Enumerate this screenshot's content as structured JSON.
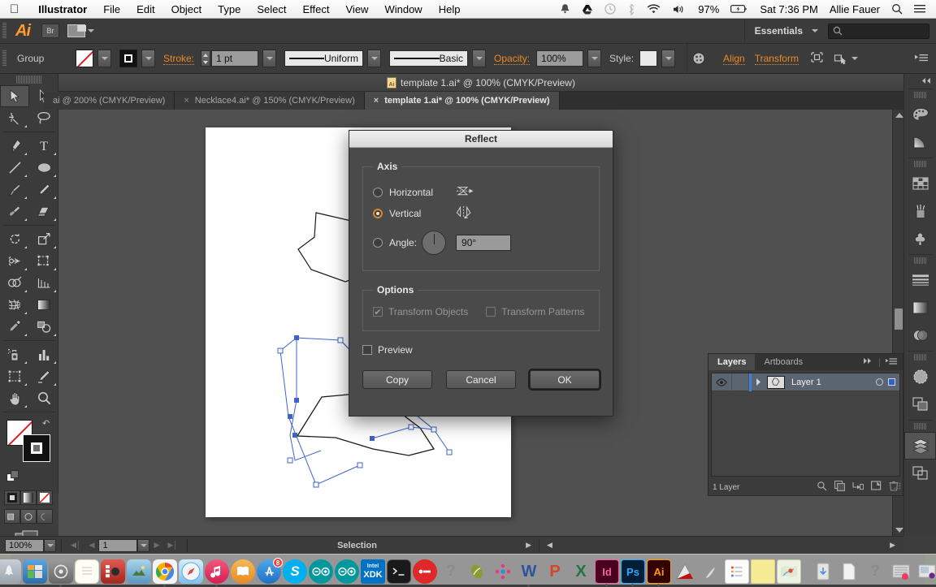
{
  "menubar": {
    "apple": "apple-logo",
    "app": "Illustrator",
    "items": [
      "File",
      "Edit",
      "Object",
      "Type",
      "Select",
      "Effect",
      "View",
      "Window",
      "Help"
    ],
    "status": {
      "battery": "97%",
      "datetime": "Sat 7:36 PM",
      "user": "Allie Fauer",
      "icons": [
        "bell-icon",
        "drive-icon",
        "time-machine-icon",
        "bluetooth-icon",
        "wifi-icon",
        "volume-icon",
        "battery-icon",
        "spotlight-icon",
        "notification-center-icon"
      ]
    }
  },
  "appbar": {
    "logo": "Ai",
    "bridge_label": "Br",
    "arrange_label": "arrange-documents",
    "workspace": "Essentials",
    "search_placeholder": ""
  },
  "control": {
    "selection_label": "Group",
    "fill_label": "fill-none",
    "stroke_swatch_label": "stroke-black",
    "stroke_label": "Stroke:",
    "stroke_weight": "1 pt",
    "variable_width": "Uniform",
    "brush": "Basic",
    "opacity_label": "Opacity:",
    "opacity_value": "100%",
    "style_label": "Style:",
    "align_label": "Align",
    "transform_label": "Transform",
    "isolate_icon": "isolate-selected-object-icon",
    "select_similar_icon": "select-similar-objects-icon",
    "panel_menu_icon": "panel-menu-icon"
  },
  "document": {
    "title": "template 1.ai* @ 100% (CMYK/Preview)",
    "tabs": [
      {
        "label": "ai @ 200% (CMYK/Preview)",
        "active": false,
        "closable": false
      },
      {
        "label": "Necklace4.ai* @ 150% (CMYK/Preview)",
        "active": false,
        "closable": true
      },
      {
        "label": "template 1.ai* @ 100% (CMYK/Preview)",
        "active": true,
        "closable": true
      }
    ],
    "close_label": "×"
  },
  "tools": [
    {
      "name": "selection-tool",
      "selected": true
    },
    {
      "name": "direct-selection-tool",
      "selected": false
    },
    {
      "name": "magic-wand-tool",
      "selected": false
    },
    {
      "name": "lasso-tool",
      "selected": false
    },
    {
      "name": "pen-tool",
      "selected": false
    },
    {
      "name": "type-tool",
      "selected": false
    },
    {
      "name": "line-segment-tool",
      "selected": false
    },
    {
      "name": "ellipse-tool",
      "selected": false
    },
    {
      "name": "paintbrush-tool",
      "selected": false
    },
    {
      "name": "pencil-tool",
      "selected": false
    },
    {
      "name": "blob-brush-tool",
      "selected": false
    },
    {
      "name": "eraser-tool",
      "selected": false
    },
    {
      "name": "rotate-tool",
      "selected": false
    },
    {
      "name": "scale-tool",
      "selected": false
    },
    {
      "name": "width-tool",
      "selected": false
    },
    {
      "name": "free-transform-tool",
      "selected": false
    },
    {
      "name": "shape-builder-tool",
      "selected": false
    },
    {
      "name": "perspective-grid-tool",
      "selected": false
    },
    {
      "name": "mesh-tool",
      "selected": false
    },
    {
      "name": "gradient-tool",
      "selected": false
    },
    {
      "name": "eyedropper-tool",
      "selected": false
    },
    {
      "name": "blend-tool",
      "selected": false
    },
    {
      "name": "symbol-sprayer-tool",
      "selected": false
    },
    {
      "name": "column-graph-tool",
      "selected": false
    },
    {
      "name": "artboard-tool",
      "selected": false
    },
    {
      "name": "slice-tool",
      "selected": false
    },
    {
      "name": "hand-tool",
      "selected": false
    },
    {
      "name": "zoom-tool",
      "selected": false
    }
  ],
  "dialog": {
    "title": "Reflect",
    "axis_legend": "Axis",
    "horizontal_label": "Horizontal",
    "horizontal_selected": false,
    "vertical_label": "Vertical",
    "vertical_selected": true,
    "angle_label": "Angle:",
    "angle_selected": false,
    "angle_value": "90°",
    "options_legend": "Options",
    "transform_objects_label": "Transform Objects",
    "transform_objects_checked": true,
    "transform_patterns_label": "Transform Patterns",
    "transform_patterns_checked": false,
    "preview_label": "Preview",
    "preview_checked": false,
    "copy_label": "Copy",
    "cancel_label": "Cancel",
    "ok_label": "OK",
    "check_glyph": "✔"
  },
  "layers": {
    "tabs": [
      {
        "label": "Layers",
        "active": true
      },
      {
        "label": "Artboards",
        "active": false
      }
    ],
    "collapse_icon": "collapse-panel-icon",
    "menu_icon": "panel-menu-icon",
    "rows": [
      {
        "name": "Layer 1",
        "visible": true,
        "selected": true
      }
    ],
    "footer_count": "1 Layer",
    "footer_icons": [
      "locate-object-icon",
      "make-clipping-mask-icon",
      "create-new-sublayer-icon",
      "create-new-layer-icon",
      "delete-selection-icon"
    ]
  },
  "right_dock": {
    "collapse_label": "«",
    "items": [
      {
        "name": "color-panel-icon",
        "active": false
      },
      {
        "name": "color-guide-panel-icon",
        "active": false
      },
      {
        "name": "swatches-panel-icon",
        "active": false
      },
      {
        "name": "brushes-panel-icon",
        "active": false
      },
      {
        "name": "symbols-panel-icon",
        "active": false
      },
      {
        "name": "stroke-panel-icon",
        "active": false
      },
      {
        "name": "gradient-panel-icon",
        "active": false
      },
      {
        "name": "transparency-panel-icon",
        "active": false
      },
      {
        "name": "appearance-panel-icon",
        "active": false
      },
      {
        "name": "graphic-styles-panel-icon",
        "active": false
      },
      {
        "name": "layers-panel-icon",
        "active": true
      },
      {
        "name": "artboards-panel-icon",
        "active": false
      }
    ]
  },
  "statusbar": {
    "zoom": "100%",
    "artboard_number": "1",
    "status_text": "Selection"
  },
  "dock": {
    "apps": [
      {
        "name": "finder",
        "label": "",
        "color": "#3da7e8",
        "running": true
      },
      {
        "name": "launchpad",
        "label": "",
        "color": "#9aa3ad",
        "running": false
      },
      {
        "name": "mission-control",
        "label": "",
        "color": "#4a8ed8",
        "running": false
      },
      {
        "name": "system-preferences",
        "label": "",
        "color": "#7d7d7d",
        "running": true
      },
      {
        "name": "notes",
        "label": "",
        "color": "#fdfdf4",
        "running": false
      },
      {
        "name": "photo-booth",
        "label": "",
        "color": "#d1403a",
        "running": false
      },
      {
        "name": "image-capture",
        "label": "",
        "color": "#6fa8cd",
        "running": false
      },
      {
        "name": "google-chrome",
        "label": "",
        "color": "#e8e8e8",
        "running": true
      },
      {
        "name": "safari",
        "label": "",
        "color": "#2b8fe0",
        "running": false
      },
      {
        "name": "itunes",
        "label": "",
        "color": "#ee3b62",
        "running": true
      },
      {
        "name": "ibooks",
        "label": "",
        "color": "#f5a623",
        "running": false
      },
      {
        "name": "app-store",
        "label": "",
        "color": "#2b8fe0",
        "running": false,
        "badge": "8"
      },
      {
        "name": "skype",
        "label": "S",
        "color": "#00aff0",
        "running": false
      },
      {
        "name": "arduino",
        "label": "",
        "color": "#00979d",
        "running": false
      },
      {
        "name": "arduino-ide",
        "label": "",
        "color": "#00979d",
        "running": false
      },
      {
        "name": "intel-xdk",
        "label": "XDK",
        "color": "#0071c5",
        "running": false
      },
      {
        "name": "terminal",
        "label": "",
        "color": "#1d1d1d",
        "running": false
      },
      {
        "name": "cisco-anyconnect",
        "label": "",
        "color": "#e02020",
        "running": false
      },
      {
        "name": "help-viewer",
        "label": "?",
        "color": "#cfcfcf",
        "running": false
      },
      {
        "name": "scratch",
        "label": "",
        "color": "#8a9a3a",
        "running": false
      },
      {
        "name": "microsoft-office",
        "label": "",
        "color": "#e8388a",
        "running": false
      },
      {
        "name": "microsoft-word",
        "label": "W",
        "color": "#2b579a",
        "running": true
      },
      {
        "name": "microsoft-powerpoint",
        "label": "P",
        "color": "#d24726",
        "running": false
      },
      {
        "name": "microsoft-excel",
        "label": "X",
        "color": "#217346",
        "running": false
      },
      {
        "name": "indesign",
        "label": "Id",
        "color": "#49021f",
        "running": true
      },
      {
        "name": "photoshop",
        "label": "Ps",
        "color": "#001e36",
        "running": true
      },
      {
        "name": "illustrator",
        "label": "Ai",
        "color": "#330000",
        "running": true
      },
      {
        "name": "acrobat",
        "label": "",
        "color": "#b30b00",
        "running": false
      },
      {
        "name": "preview",
        "label": "",
        "color": "#dedede",
        "running": false
      },
      {
        "name": "reminders",
        "label": "",
        "color": "#f2f2f2",
        "running": false
      },
      {
        "name": "stickies",
        "label": "",
        "color": "#f7e98a",
        "running": false
      },
      {
        "name": "maps",
        "label": "",
        "color": "#e8f0e0",
        "running": false
      }
    ],
    "stacks": [
      {
        "name": "downloads-stack",
        "color": "#dcdcdc"
      },
      {
        "name": "documents-stack",
        "color": "#f0f0f0"
      },
      {
        "name": "help-stack",
        "color": "#c8c8c8"
      },
      {
        "name": "music-stack",
        "color": "#e0e0e0"
      },
      {
        "name": "screenshots-stack",
        "color": "#d8d8d8"
      },
      {
        "name": "trash",
        "color": "#e4e4e4"
      }
    ]
  },
  "artwork": {
    "description": "selected-vector-path",
    "stroke_color": "#1a1a1a",
    "selection_color": "#3e64c8"
  }
}
